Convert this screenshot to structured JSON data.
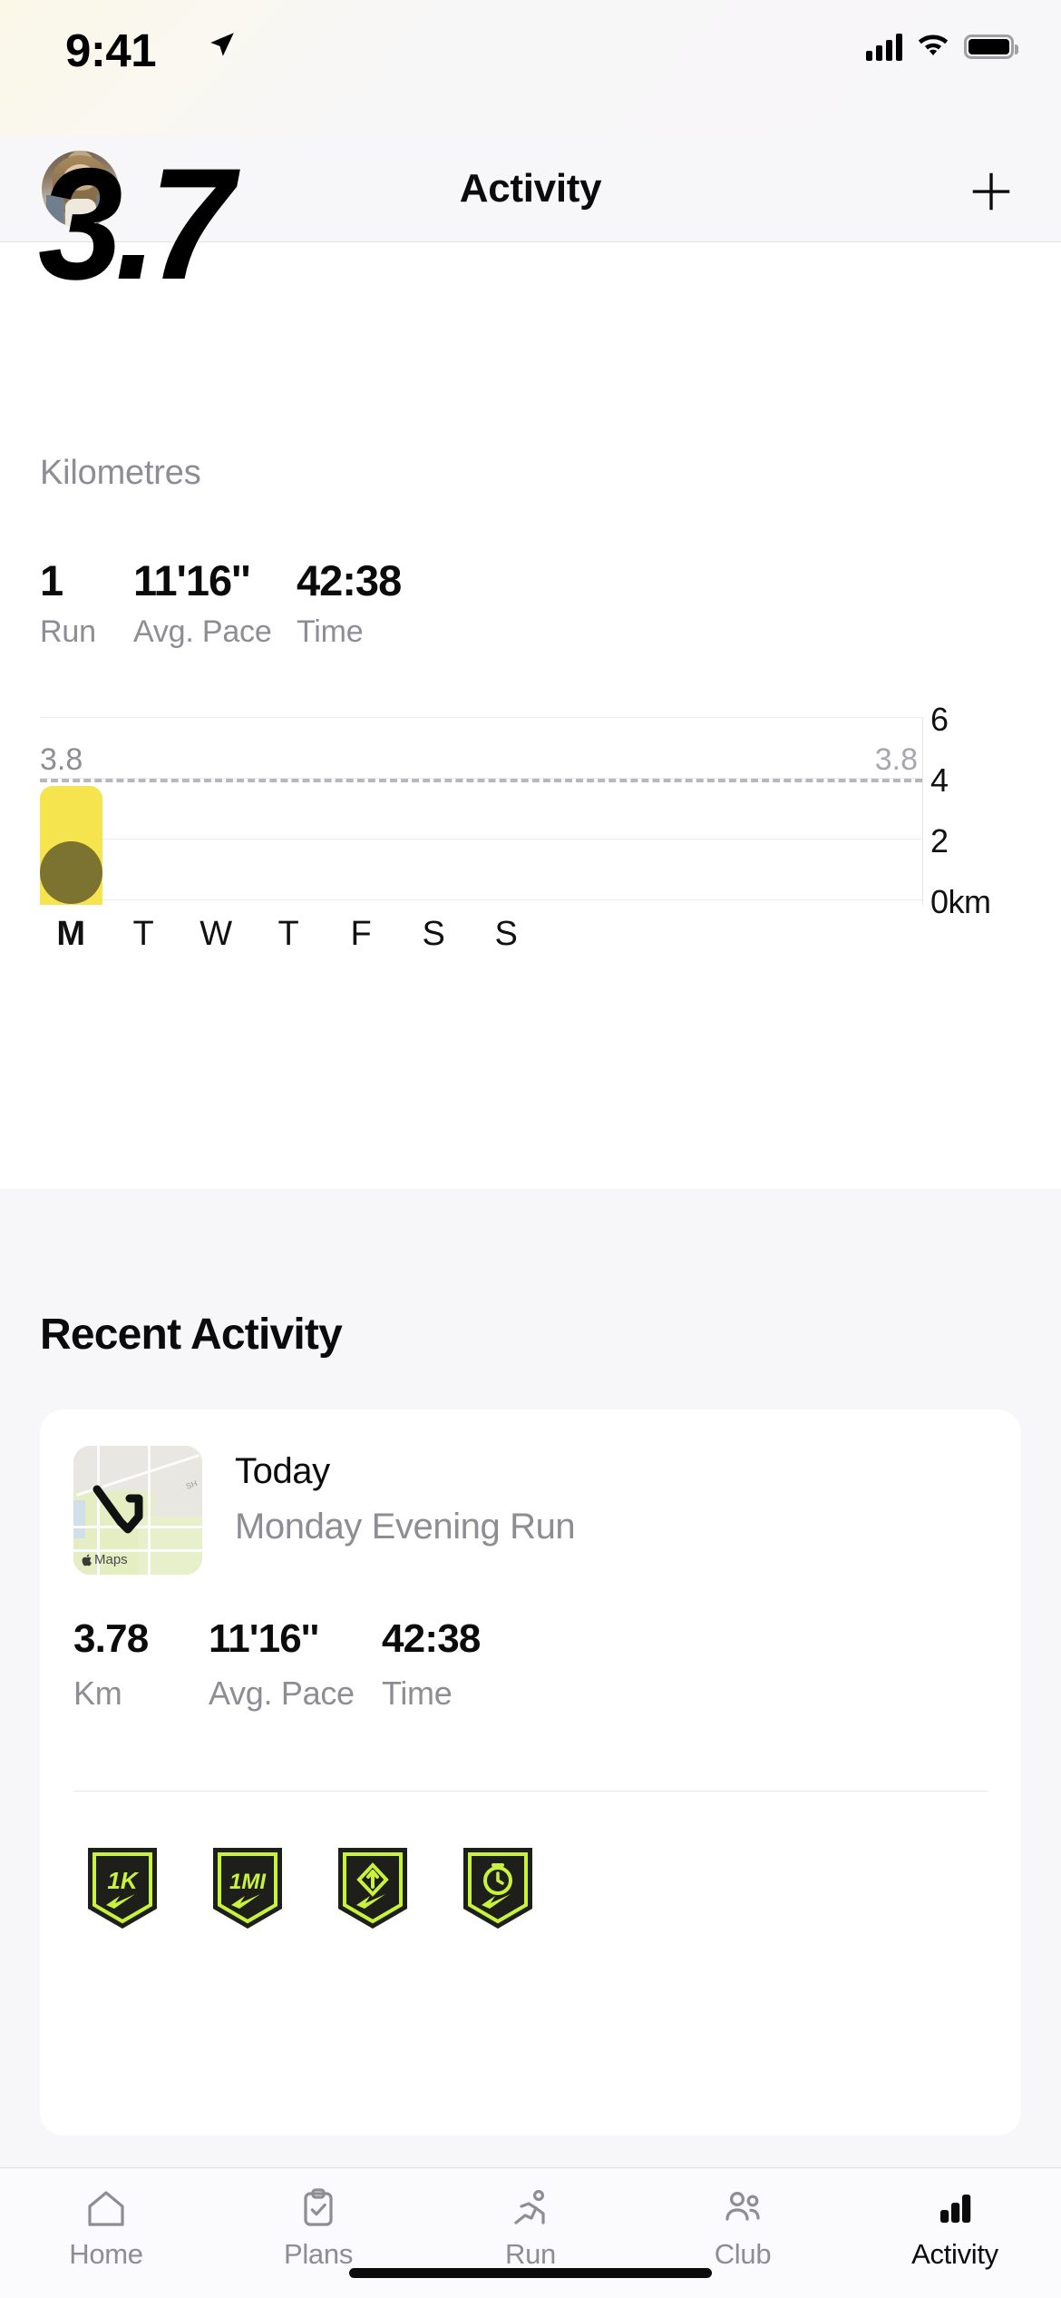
{
  "status_bar": {
    "time": "9:41",
    "location_icon": "location-arrow-icon",
    "cellular_icon": "cellular-bars-icon",
    "wifi_icon": "wifi-icon",
    "battery_icon": "battery-full-icon"
  },
  "nav": {
    "title": "Activity",
    "avatar_name": "profile-avatar",
    "add_label": "+"
  },
  "summary": {
    "distance": "3.7",
    "unit": "Kilometres",
    "stats": [
      {
        "value": "1",
        "label": "Run"
      },
      {
        "value": "11'16''",
        "label": "Avg. Pace"
      },
      {
        "value": "42:38",
        "label": "Time"
      }
    ]
  },
  "chart_data": {
    "type": "bar",
    "title": "",
    "xlabel": "",
    "ylabel": "km",
    "categories": [
      "M",
      "T",
      "W",
      "T",
      "F",
      "S",
      "S"
    ],
    "values": [
      3.8,
      0,
      0,
      0,
      0,
      0,
      0
    ],
    "active_category_index": 0,
    "ylim": [
      0,
      6
    ],
    "yticks": [
      "0km",
      "2",
      "4",
      "6"
    ],
    "ytick_values": [
      0,
      2,
      4,
      6
    ],
    "grid": true,
    "legend": "none",
    "axis_position": "right",
    "average_line": {
      "value": 3.8,
      "label_left": "3.8",
      "label_right": "3.8",
      "style": "dashed"
    },
    "bar_color": "#F5E44E",
    "marker_color": "#7D7330"
  },
  "recent": {
    "section_title": "Recent Activity",
    "card": {
      "map_watermark": "Maps",
      "date": "Today",
      "name": "Monday Evening Run",
      "stats": [
        {
          "value": "3.78",
          "label": "Km"
        },
        {
          "value": "11'16''",
          "label": "Avg. Pace"
        },
        {
          "value": "42:38",
          "label": "Time"
        }
      ],
      "badges": [
        {
          "name": "badge-1k",
          "text": "1K",
          "icon": "swoosh-icon"
        },
        {
          "name": "badge-1mi",
          "text": "1MI",
          "icon": "swoosh-icon"
        },
        {
          "name": "badge-fastest-distance",
          "text": "",
          "icon": "diamond-arrow-icon"
        },
        {
          "name": "badge-fastest-time",
          "text": "",
          "icon": "stopwatch-icon"
        }
      ],
      "badge_border_color": "#C8F23C",
      "badge_bg_color": "#1E1E1B"
    }
  },
  "tabbar": {
    "items": [
      {
        "label": "Home",
        "icon": "home-icon",
        "active": false
      },
      {
        "label": "Plans",
        "icon": "clipboard-check-icon",
        "active": false
      },
      {
        "label": "Run",
        "icon": "runner-icon",
        "active": false
      },
      {
        "label": "Club",
        "icon": "people-icon",
        "active": false
      },
      {
        "label": "Activity",
        "icon": "bar-chart-icon",
        "active": true
      }
    ]
  }
}
